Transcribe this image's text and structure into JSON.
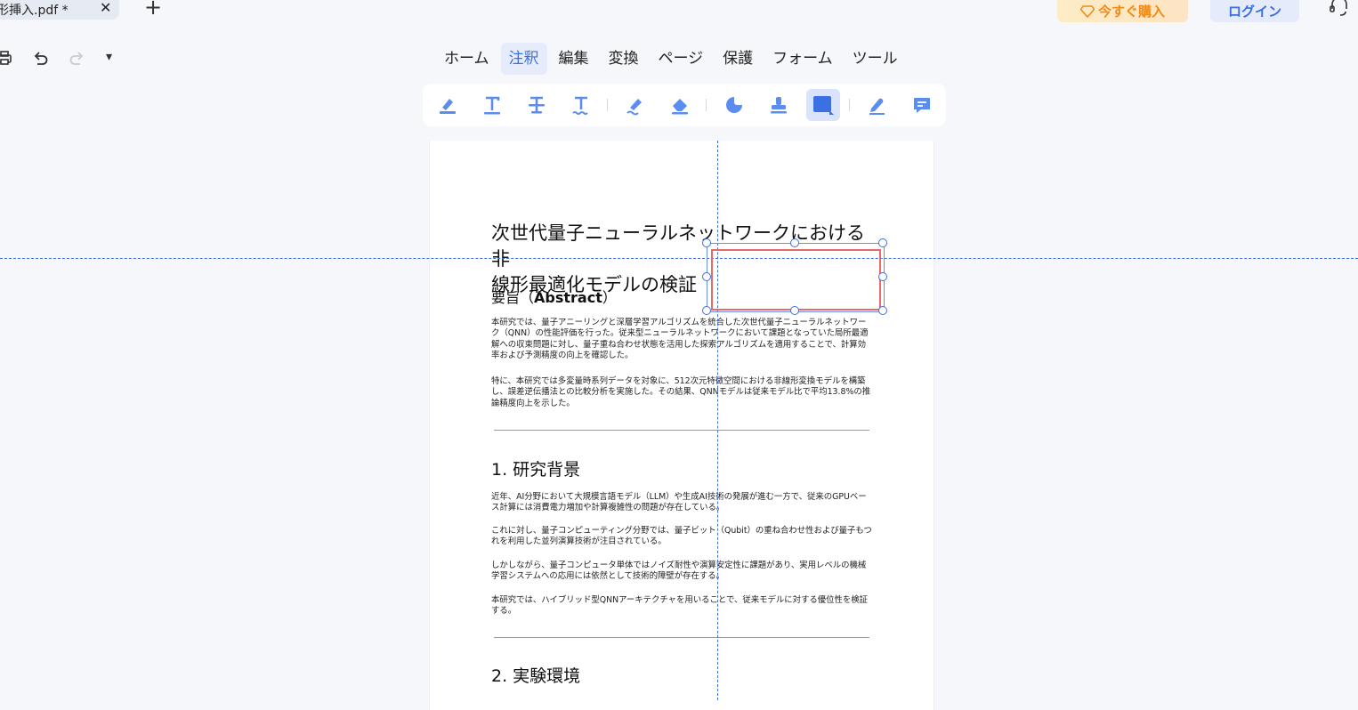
{
  "tab": {
    "title": "形挿入.pdf *",
    "close": "✕",
    "new": "+"
  },
  "header": {
    "buy_label": "今すぐ購入",
    "login_label": "ログイン"
  },
  "menu": [
    "ホーム",
    "注釈",
    "編集",
    "変換",
    "ページ",
    "保護",
    "フォーム",
    "ツール"
  ],
  "menu_active": "注釈",
  "quick_access": {
    "more": "▾"
  },
  "toolbar": {
    "tools": [
      "highlight-tool",
      "text-tool",
      "strikethrough-tool",
      "underline-tool",
      "pencil-tool",
      "eraser-tool",
      "sticker-tool",
      "stamp-tool",
      "shape-tool",
      "signature-tool",
      "comment-tool"
    ],
    "active": "shape-tool"
  },
  "colors": {
    "accent": "#3b6fe4",
    "shape_border": "#e66a6a",
    "buy": "#f08a16"
  },
  "document": {
    "title_line1": "次世代量子ニューラルネットワークにおける非",
    "title_line2": "線形最適化モデルの検証",
    "abstract_heading_prefix": "要旨（",
    "abstract_heading_bold": "Abstract",
    "abstract_heading_suffix": "）",
    "abstract_p1": "本研究では、量子アニーリングと深層学習アルゴリズムを統合した次世代量子ニューラルネットワーク（QNN）の性能評価を行った。従来型ニューラルネットワークにおいて課題となっていた局所最適解への収束問題に対し、量子重ね合わせ状態を活用した探索アルゴリズムを適用することで、計算効率および予測精度の向上を確認した。",
    "abstract_p2": "特に、本研究では多変量時系列データを対象に、512次元特徴空間における非線形変換モデルを構築し、誤差逆伝播法との比較分析を実施した。その結果、QNNモデルは従来モデル比で平均13.8%の推論精度向上を示した。",
    "section1_heading": "1. 研究背景",
    "s1_p1": "近年、AI分野において大規模言語モデル（LLM）や生成AI技術の発展が進む一方で、従来のGPUベース計算には消費電力増加や計算複雑性の問題が存在している。",
    "s1_p2": "これに対し、量子コンピューティング分野では、量子ビット（Qubit）の重ね合わせ性および量子もつれを利用した並列演算技術が注目されている。",
    "s1_p3": "しかしながら、量子コンピュータ単体ではノイズ耐性や演算安定性に課題があり、実用レベルの機械学習システムへの応用には依然として技術的障壁が存在する。",
    "s1_p4": "本研究では、ハイブリッド型QNNアーキテクチャを用いることで、従来モデルに対する優位性を検証する。",
    "section2_heading": "2. 実験環境"
  }
}
